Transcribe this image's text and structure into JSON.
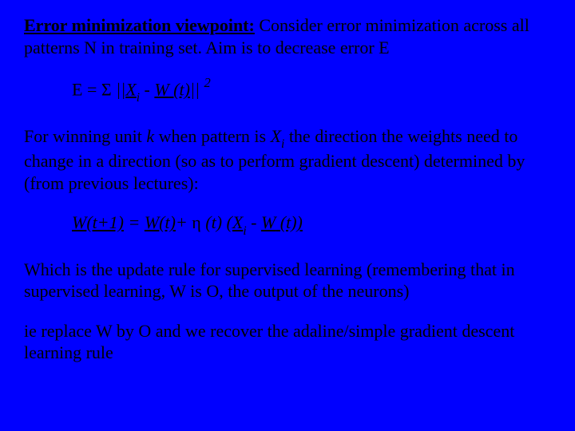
{
  "para1_head": "Error minimization viewpoint:",
  "para1_rest": " Consider error minimization across all patterns N in training set. Aim is to decrease error E",
  "formula1": {
    "lhs_rm": "E = ",
    "sigma": "Σ",
    "bar1": "  ||",
    "X": "X",
    "i1": "i",
    "minus": " - ",
    "W": "W",
    "t": " (t)",
    "bar2": "|| ",
    "exp": "2"
  },
  "para2_a": "For winning unit ",
  "para2_k": "k",
  "para2_b": " when pattern is ",
  "para2_X": "X",
  "para2_i": "i",
  "para2_c": "  the direction the weights need to change in a direction (so as to perform gradient descent) determined by (from previous lectures):",
  "formula2": {
    "W1": "W",
    "t1": "(t+1)",
    "eq": "  = ",
    "W2": "W",
    "t2": "(t)",
    "plus": "+ ",
    "eta": "η",
    "t3": " (t) (",
    "X": "X",
    "i": "i",
    "minus": " - ",
    "W3": "W",
    "t4": " (t))"
  },
  "para3": "Which is the update rule for supervised learning (remembering that in supervised learning, W is O, the output of the neurons)",
  "para4": "ie replace W by O and we recover the adaline/simple gradient descent learning rule"
}
